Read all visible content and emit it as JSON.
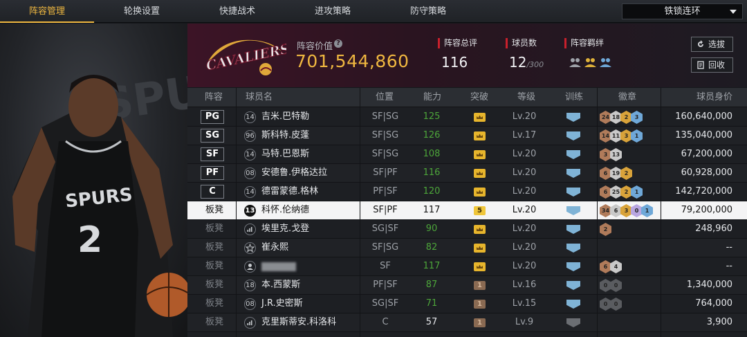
{
  "tabs": [
    "阵容管理",
    "轮换设置",
    "快捷战术",
    "进攻策略",
    "防守策略"
  ],
  "active_tab": 0,
  "lineup_select": "铁锁连环",
  "team_logo_text": "CAVALIERS",
  "lineup_value": {
    "label": "阵容价值",
    "value": "701,544,860"
  },
  "stats": {
    "rating_label": "阵容总评",
    "rating": "116",
    "count_label": "球员数",
    "count": "12",
    "count_max": "/300",
    "bond_label": "阵容羁绊"
  },
  "buttons": {
    "select": "选拔",
    "recycle": "回收"
  },
  "columns": {
    "lineup": "阵容",
    "name": "球员名",
    "position": "位置",
    "ability": "能力",
    "breakthrough": "突破",
    "level": "等级",
    "training": "训练",
    "badges": "徽章",
    "price": "球员身价"
  },
  "rows": [
    {
      "slot": "PG",
      "num": "14",
      "name": "吉米.巴特勒",
      "pos": "SF|SG",
      "ability": "125",
      "ability_color": "green",
      "breakthrough": "crown",
      "level": "Lv.20",
      "training": "blue",
      "badges": [
        [
          "24",
          "bronze"
        ],
        [
          "18",
          "silver"
        ],
        [
          "2",
          "gold"
        ],
        [
          "3",
          "blue"
        ]
      ],
      "price": "160,640,000"
    },
    {
      "slot": "SG",
      "num": "96",
      "name": "斯科特.皮蓬",
      "pos": "SF|SG",
      "ability": "126",
      "ability_color": "green",
      "breakthrough": "crown",
      "level": "Lv.17",
      "training": "blue",
      "badges": [
        [
          "14",
          "bronze"
        ],
        [
          "11",
          "silver"
        ],
        [
          "3",
          "gold"
        ],
        [
          "1",
          "blue"
        ]
      ],
      "price": "135,040,000"
    },
    {
      "slot": "SF",
      "num": "14",
      "name": "马特.巴恩斯",
      "pos": "SF|SG",
      "ability": "108",
      "ability_color": "green",
      "breakthrough": "crown",
      "level": "Lv.20",
      "training": "blue",
      "badges": [
        [
          "3",
          "bronze"
        ],
        [
          "13",
          "silver"
        ]
      ],
      "price": "67,200,000"
    },
    {
      "slot": "PF",
      "num": "08",
      "name": "安德鲁.伊格达拉",
      "pos": "SF|PF",
      "ability": "116",
      "ability_color": "green",
      "breakthrough": "crown",
      "level": "Lv.20",
      "training": "blue",
      "badges": [
        [
          "6",
          "bronze"
        ],
        [
          "19",
          "silver"
        ],
        [
          "2",
          "gold"
        ]
      ],
      "price": "60,928,000"
    },
    {
      "slot": "C",
      "num": "14",
      "name": "德雷蒙德.格林",
      "pos": "PF|SF",
      "ability": "120",
      "ability_color": "green",
      "breakthrough": "crown",
      "level": "Lv.20",
      "training": "blue",
      "badges": [
        [
          "6",
          "bronze"
        ],
        [
          "25",
          "silver"
        ],
        [
          "2",
          "gold"
        ],
        [
          "1",
          "blue"
        ]
      ],
      "price": "142,720,000"
    },
    {
      "slot": "板凳",
      "num": "13",
      "name": "科怀.伦纳德",
      "pos": "SF|PF",
      "ability": "117",
      "ability_color": "white",
      "breakthrough": "5",
      "level": "Lv.20",
      "training": "blue",
      "badges": [
        [
          "34",
          "bronze"
        ],
        [
          "6",
          "silver"
        ],
        [
          "3",
          "gold"
        ],
        [
          "0",
          "purple"
        ],
        [
          "1",
          "blue"
        ]
      ],
      "price": "79,200,000",
      "selected": true
    },
    {
      "slot": "板凳",
      "num": "",
      "name": "埃里克.戈登",
      "pos": "SG|SF",
      "ability": "90",
      "ability_color": "green",
      "breakthrough": "crown",
      "level": "Lv.20",
      "training": "blue",
      "badges": [
        [
          "2",
          "bronze"
        ]
      ],
      "price": "248,960"
    },
    {
      "slot": "板凳",
      "num": "",
      "name": "崔永熙",
      "pos": "SF|SG",
      "ability": "82",
      "ability_color": "green",
      "breakthrough": "crown",
      "level": "Lv.20",
      "training": "blue",
      "badges": [],
      "price": "--"
    },
    {
      "slot": "板凳",
      "num": "",
      "name": "",
      "pos": "SF",
      "ability": "117",
      "ability_color": "green",
      "breakthrough": "crown",
      "level": "Lv.20",
      "training": "blue",
      "badges": [
        [
          "6",
          "bronze"
        ],
        [
          "4",
          "silver"
        ]
      ],
      "price": "--"
    },
    {
      "slot": "板凳",
      "num": "18",
      "name": "本.西蒙斯",
      "pos": "PF|SF",
      "ability": "87",
      "ability_color": "green",
      "breakthrough": "1",
      "level": "Lv.16",
      "training": "blue",
      "badges": [
        [
          "0",
          "grey"
        ],
        [
          "0",
          "grey"
        ]
      ],
      "price": "1,340,000"
    },
    {
      "slot": "板凳",
      "num": "08",
      "name": "J.R.史密斯",
      "pos": "SG|SF",
      "ability": "71",
      "ability_color": "green",
      "breakthrough": "1",
      "level": "Lv.15",
      "training": "blue",
      "badges": [
        [
          "0",
          "grey"
        ],
        [
          "0",
          "grey"
        ]
      ],
      "price": "764,000"
    },
    {
      "slot": "板凳",
      "num": "",
      "name": "克里斯蒂安.科洛科",
      "pos": "C",
      "ability": "57",
      "ability_color": "white",
      "breakthrough": "1",
      "level": "Lv.9",
      "training": "grey",
      "badges": [],
      "price": "3,900"
    }
  ],
  "colors": {
    "accent": "#f0b840",
    "green": "#4da63a",
    "red_marker": "#c8202c",
    "bronze": "#b07b5a",
    "silver": "#c9c9c9",
    "gold": "#d9a33a",
    "blue": "#6fa8d8",
    "purple": "#b9a6e0",
    "grey": "#5a5c60"
  }
}
